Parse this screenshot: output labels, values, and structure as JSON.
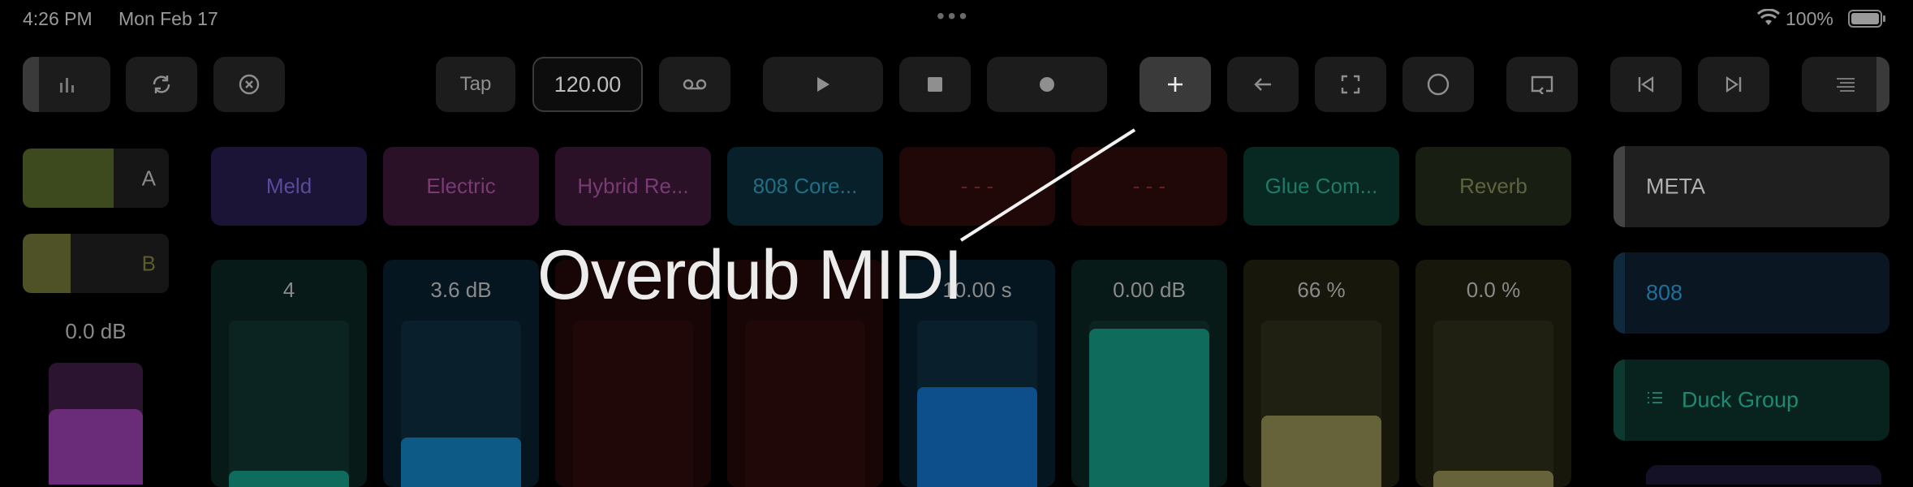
{
  "status_bar": {
    "time": "4:26 PM",
    "date": "Mon Feb 17",
    "more": "•••",
    "battery_percent": "100%",
    "battery_level": 1.0,
    "wifi_icon": "wifi-icon",
    "battery_icon": "battery-icon"
  },
  "toolbar": {
    "tap_label": "Tap",
    "tempo_value": "120.00",
    "icons": [
      "levels-icon",
      "loop-sync-icon",
      "close-circle-icon",
      "tape-icon",
      "play-icon",
      "stop-icon",
      "record-icon",
      "plus-icon",
      "arrow-left-icon",
      "fullscreen-icon",
      "circle-icon",
      "return-icon",
      "skip-back-icon",
      "skip-forward-icon",
      "menu-icon"
    ]
  },
  "macros": [
    {
      "label": "A",
      "level": 0.62,
      "fill_color": "#3c4a1e",
      "label_color": "#8a8a8a"
    },
    {
      "label": "B",
      "level": 0.33,
      "fill_color": "#4f5127",
      "label_color": "#5d5d2c"
    }
  ],
  "master_volume": {
    "value": "0.0 dB",
    "level": 0.62,
    "color": "#6a2c78",
    "track_color": "#2a1430"
  },
  "devices": [
    {
      "name": "Meld",
      "bg": "#1c1436",
      "color": "#5a4a9a"
    },
    {
      "name": "Electric",
      "bg": "#2a1128",
      "color": "#7a3a74"
    },
    {
      "name": "Hybrid Re...",
      "bg": "#2a1128",
      "color": "#7a3a74"
    },
    {
      "name": "808 Core...",
      "bg": "#07202a",
      "color": "#1f6f86"
    },
    {
      "name": "- - -",
      "bg": "#200808",
      "color": "#6e1d1d"
    },
    {
      "name": "- - -",
      "bg": "#200808",
      "color": "#6e1d1d"
    },
    {
      "name": "Glue Com...",
      "bg": "#082822",
      "color": "#1f7a68"
    },
    {
      "name": "Reverb",
      "bg": "#181e12",
      "color": "#5e6440"
    }
  ],
  "params": [
    {
      "value": "4",
      "level": 0.1,
      "bg": "#071a18",
      "track": "#0c2421",
      "bar": "#0f6c5c"
    },
    {
      "value": "3.6 dB",
      "level": 0.3,
      "bg": "#061620",
      "track": "#0a1f2c",
      "bar": "#0d5a86"
    },
    {
      "value": "",
      "level": 0.0,
      "bg": "#180606",
      "track": "#200808",
      "bar": "#3a0d0d"
    },
    {
      "value": "",
      "level": 0.0,
      "bg": "#180606",
      "track": "#200808",
      "bar": "#3a0d0d"
    },
    {
      "value": "10.00 s",
      "level": 0.6,
      "bg": "#061620",
      "track": "#0a1f2c",
      "bar": "#0c4f8a"
    },
    {
      "value": "0.00 dB",
      "level": 0.95,
      "bg": "#071a18",
      "track": "#0c2421",
      "bar": "#0f6c5c"
    },
    {
      "value": "66 %",
      "level": 0.43,
      "bg": "#17170c",
      "track": "#1f1f12",
      "bar": "#66623a"
    },
    {
      "value": "0.0 %",
      "level": 0.1,
      "bg": "#17170c",
      "track": "#1f1f12",
      "bar": "#66623a"
    }
  ],
  "right_panel": {
    "meta_label": "META",
    "track_label": "808",
    "group_label": "Duck Group",
    "group_icon": "list-icon"
  },
  "overlay": {
    "label": "Overdub MIDI"
  }
}
